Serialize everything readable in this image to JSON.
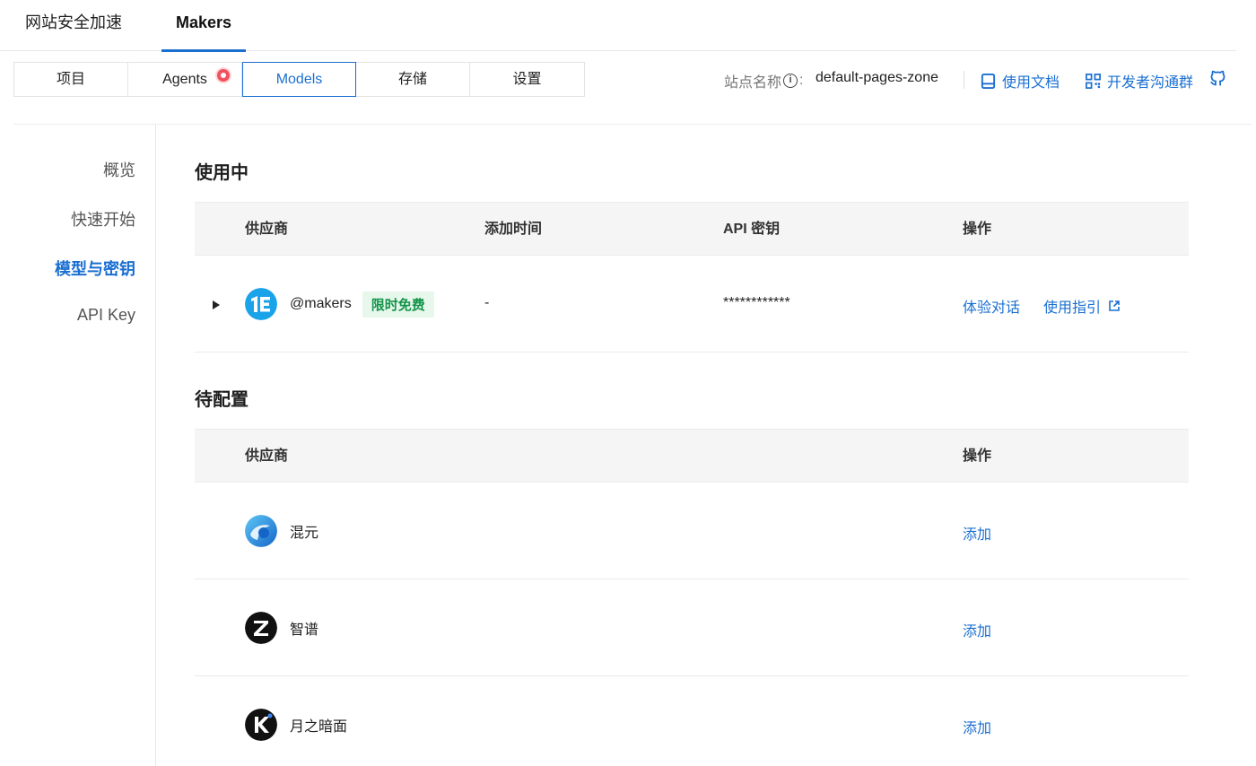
{
  "top_tabs": [
    "网站安全加速",
    "Makers"
  ],
  "nav": {
    "items": [
      "项目",
      "Agents",
      "Models",
      "存储",
      "设置"
    ],
    "active": "Models"
  },
  "header": {
    "site_label": "站点名称",
    "site_label_colon": ":",
    "site_name": "default-pages-zone",
    "docs_link": "使用文档",
    "dev_group_link": "开发者沟通群"
  },
  "sidebar": {
    "items": [
      "概览",
      "快速开始",
      "模型与密钥",
      "API Key"
    ],
    "active": "模型与密钥"
  },
  "in_use": {
    "title": "使用中",
    "columns": [
      "供应商",
      "添加时间",
      "API 密钥",
      "操作"
    ],
    "rows": [
      {
        "provider": "@makers",
        "tag": "限时免费",
        "added_time": "-",
        "api_key": "************",
        "action_chat": "体验对话",
        "action_guide": "使用指引"
      }
    ]
  },
  "pending": {
    "title": "待配置",
    "columns": [
      "供应商",
      "操作"
    ],
    "rows": [
      {
        "provider": "混元",
        "action": "添加"
      },
      {
        "provider": "智谱",
        "action": "添加"
      },
      {
        "provider": "月之暗面",
        "action": "添加"
      }
    ]
  },
  "icons": [
    "info-icon",
    "book-icon",
    "qrcode-icon",
    "github-icon",
    "external-link-icon",
    "expand-arrow-icon"
  ],
  "colors": {
    "accent": "#1a6fd1",
    "tag_bg": "#e8f7ec",
    "tag_text": "#14944a",
    "badge_red": "#f0535f"
  }
}
